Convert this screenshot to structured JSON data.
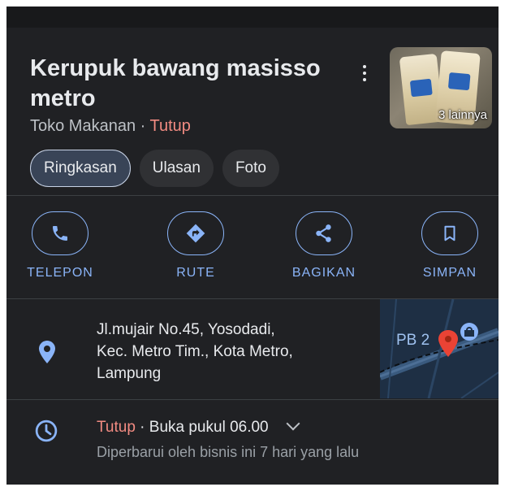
{
  "place": {
    "name": "Kerupuk bawang masisso metro",
    "category": "Toko Makanan",
    "separator": " · ",
    "status": "Tutup"
  },
  "photo": {
    "more_label": "3 lainnya"
  },
  "tabs": [
    {
      "label": "Ringkasan",
      "active": true
    },
    {
      "label": "Ulasan",
      "active": false
    },
    {
      "label": "Foto",
      "active": false
    }
  ],
  "actions": [
    {
      "label": "TELEPON",
      "icon": "phone-icon"
    },
    {
      "label": "RUTE",
      "icon": "directions-icon"
    },
    {
      "label": "BAGIKAN",
      "icon": "share-icon"
    },
    {
      "label": "SIMPAN",
      "icon": "bookmark-icon"
    }
  ],
  "address": {
    "line1": "Jl.mujair No.45, Yosodadi,",
    "line2": "Kec. Metro Tim., Kota Metro,",
    "line3": "Lampung"
  },
  "map": {
    "label": "PB 2"
  },
  "hours": {
    "status": "Tutup",
    "separator": " · ",
    "next": "Buka pukul 06.00",
    "updated": "Diperbarui oleh bisnis ini 7 hari yang lalu"
  },
  "colors": {
    "background": "#202124",
    "accent": "#8ab4f8",
    "closed": "#f28b82",
    "pin": "#ea4335"
  }
}
